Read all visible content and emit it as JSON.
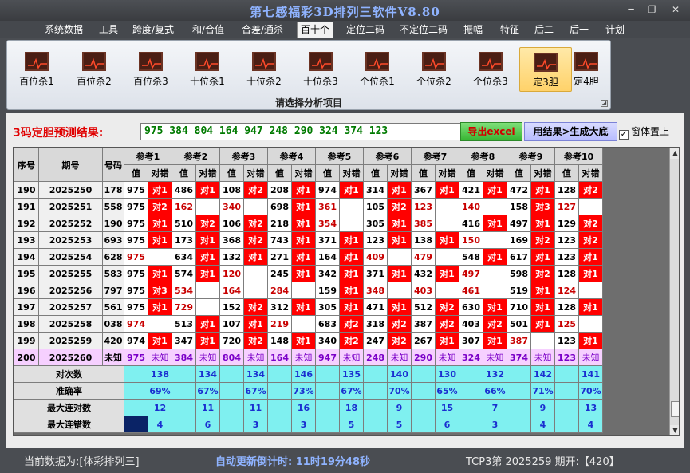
{
  "app_title": "第七感福彩3D排列三软件V8.80",
  "window_controls": {
    "minimize": "━",
    "restore": "❐",
    "close": "✕"
  },
  "menu": [
    "系统数据",
    "工具",
    "跨度/复式",
    "和/合值",
    "合差/通杀",
    "百十个",
    "定位二码",
    "不定位二码",
    "振幅",
    "特征",
    "后二",
    "后一",
    "计划"
  ],
  "menu_active": "百十个",
  "ribbon": {
    "buttons": [
      "百位杀1",
      "百位杀2",
      "百位杀3",
      "十位杀1",
      "十位杀2",
      "十位杀3",
      "个位杀1",
      "个位杀2",
      "个位杀3",
      "定3胆",
      "定4胆"
    ],
    "active": "定3胆",
    "group_label": "请选择分析项目"
  },
  "prediction": {
    "label": "3码定胆预测结果:",
    "value": "975 384 804 164 947 248 290 324 374 123",
    "excel_button": "导出excel",
    "generate_button": "用结果>生成大底",
    "topmost_label": "窗体置上",
    "topmost_checked": "✓"
  },
  "table": {
    "headers": {
      "index": "序号",
      "period": "期号",
      "number": "号码",
      "ref_prefix": "参考",
      "value": "值",
      "hitmiss": "对错"
    },
    "refs": [
      "参考1",
      "参考2",
      "参考3",
      "参考4",
      "参考5",
      "参考6",
      "参考7",
      "参考8",
      "参考9",
      "参考10"
    ],
    "rows": [
      {
        "idx": "190",
        "period": "2025250",
        "num": "178",
        "cells": [
          [
            "975",
            "对1"
          ],
          [
            "486",
            "对1"
          ],
          [
            "108",
            "对2"
          ],
          [
            "208",
            "对1"
          ],
          [
            "974",
            "对1"
          ],
          [
            "314",
            "对1"
          ],
          [
            "367",
            "对1"
          ],
          [
            "421",
            "对1"
          ],
          [
            "472",
            "对1"
          ],
          [
            "128",
            "对2"
          ]
        ]
      },
      {
        "idx": "191",
        "period": "2025251",
        "num": "558",
        "cells": [
          [
            "975",
            "对2"
          ],
          [
            "162",
            ""
          ],
          [
            "340",
            ""
          ],
          [
            "698",
            "对1"
          ],
          [
            "361",
            ""
          ],
          [
            "105",
            "对2"
          ],
          [
            "123",
            ""
          ],
          [
            "140",
            ""
          ],
          [
            "158",
            "对3"
          ],
          [
            "127",
            ""
          ]
        ]
      },
      {
        "idx": "192",
        "period": "2025252",
        "num": "190",
        "cells": [
          [
            "975",
            "对1"
          ],
          [
            "510",
            "对2"
          ],
          [
            "106",
            "对2"
          ],
          [
            "218",
            "对1"
          ],
          [
            "354",
            ""
          ],
          [
            "305",
            "对1"
          ],
          [
            "385",
            ""
          ],
          [
            "416",
            "对1"
          ],
          [
            "497",
            "对1"
          ],
          [
            "129",
            "对2"
          ]
        ]
      },
      {
        "idx": "193",
        "period": "2025253",
        "num": "693",
        "cells": [
          [
            "975",
            "对1"
          ],
          [
            "173",
            "对1"
          ],
          [
            "368",
            "对2"
          ],
          [
            "743",
            "对1"
          ],
          [
            "371",
            "对1"
          ],
          [
            "123",
            "对1"
          ],
          [
            "138",
            "对1"
          ],
          [
            "150",
            ""
          ],
          [
            "169",
            "对2"
          ],
          [
            "123",
            "对2"
          ]
        ]
      },
      {
        "idx": "194",
        "period": "2025254",
        "num": "628",
        "cells": [
          [
            "975",
            ""
          ],
          [
            "634",
            "对1"
          ],
          [
            "132",
            "对1"
          ],
          [
            "271",
            "对1"
          ],
          [
            "164",
            "对1"
          ],
          [
            "409",
            ""
          ],
          [
            "479",
            ""
          ],
          [
            "548",
            "对1"
          ],
          [
            "617",
            "对1"
          ],
          [
            "123",
            "对1"
          ]
        ]
      },
      {
        "idx": "195",
        "period": "2025255",
        "num": "583",
        "cells": [
          [
            "975",
            "对1"
          ],
          [
            "574",
            "对1"
          ],
          [
            "120",
            ""
          ],
          [
            "245",
            "对1"
          ],
          [
            "342",
            "对1"
          ],
          [
            "371",
            "对1"
          ],
          [
            "432",
            "对1"
          ],
          [
            "497",
            ""
          ],
          [
            "598",
            "对2"
          ],
          [
            "128",
            "对1"
          ]
        ]
      },
      {
        "idx": "196",
        "period": "2025256",
        "num": "797",
        "cells": [
          [
            "975",
            "对3"
          ],
          [
            "534",
            ""
          ],
          [
            "164",
            ""
          ],
          [
            "284",
            ""
          ],
          [
            "159",
            "对1"
          ],
          [
            "348",
            ""
          ],
          [
            "403",
            ""
          ],
          [
            "461",
            ""
          ],
          [
            "519",
            "对1"
          ],
          [
            "124",
            ""
          ]
        ]
      },
      {
        "idx": "197",
        "period": "2025257",
        "num": "561",
        "cells": [
          [
            "975",
            "对1"
          ],
          [
            "729",
            ""
          ],
          [
            "152",
            "对2"
          ],
          [
            "312",
            "对1"
          ],
          [
            "305",
            "对1"
          ],
          [
            "471",
            "对1"
          ],
          [
            "512",
            "对2"
          ],
          [
            "630",
            "对1"
          ],
          [
            "710",
            "对1"
          ],
          [
            "128",
            "对1"
          ]
        ]
      },
      {
        "idx": "198",
        "period": "2025258",
        "num": "038",
        "cells": [
          [
            "974",
            ""
          ],
          [
            "513",
            "对1"
          ],
          [
            "107",
            "对1"
          ],
          [
            "219",
            ""
          ],
          [
            "683",
            "对2"
          ],
          [
            "318",
            "对2"
          ],
          [
            "387",
            "对2"
          ],
          [
            "403",
            "对2"
          ],
          [
            "501",
            "对1"
          ],
          [
            "125",
            ""
          ]
        ]
      },
      {
        "idx": "199",
        "period": "2025259",
        "num": "420",
        "cells": [
          [
            "974",
            "对1"
          ],
          [
            "347",
            "对1"
          ],
          [
            "720",
            "对2"
          ],
          [
            "148",
            "对1"
          ],
          [
            "340",
            "对2"
          ],
          [
            "247",
            "对2"
          ],
          [
            "267",
            "对1"
          ],
          [
            "307",
            "对1"
          ],
          [
            "387",
            ""
          ],
          [
            "123",
            "对1"
          ]
        ]
      },
      {
        "idx": "200",
        "period": "2025260",
        "num": "未知",
        "cells": [
          [
            "975",
            "未知"
          ],
          [
            "384",
            "未知"
          ],
          [
            "804",
            "未知"
          ],
          [
            "164",
            "未知"
          ],
          [
            "947",
            "未知"
          ],
          [
            "248",
            "未知"
          ],
          [
            "290",
            "未知"
          ],
          [
            "324",
            "未知"
          ],
          [
            "374",
            "未知"
          ],
          [
            "123",
            "未知"
          ]
        ]
      }
    ],
    "stats": [
      {
        "label": "对次数",
        "values": [
          "138",
          "134",
          "134",
          "146",
          "135",
          "140",
          "130",
          "132",
          "142",
          "141"
        ]
      },
      {
        "label": "准确率",
        "values": [
          "69%",
          "67%",
          "67%",
          "73%",
          "67%",
          "70%",
          "65%",
          "66%",
          "71%",
          "70%"
        ]
      },
      {
        "label": "最大连对数",
        "values": [
          "12",
          "11",
          "11",
          "16",
          "18",
          "9",
          "15",
          "7",
          "9",
          "13"
        ]
      },
      {
        "label": "最大连错数",
        "values": [
          "4",
          "6",
          "3",
          "3",
          "5",
          "5",
          "6",
          "3",
          "4",
          "4"
        ]
      }
    ],
    "colors": {
      "hit": "#ff0000",
      "stats_bg": "#7ff0f0",
      "stats_text": "#1a2fd0",
      "last_row_bg": "#f6d0ff"
    }
  },
  "status": {
    "source": "当前数据为:[体彩排列三]",
    "countdown": "自动更新倒计时:  11时19分48秒",
    "draw": "TCP3第 2025259 期开:【420】"
  },
  "icons": {
    "ribbon_icon": "chart-icon",
    "launcher": "dialog-launcher-icon"
  }
}
